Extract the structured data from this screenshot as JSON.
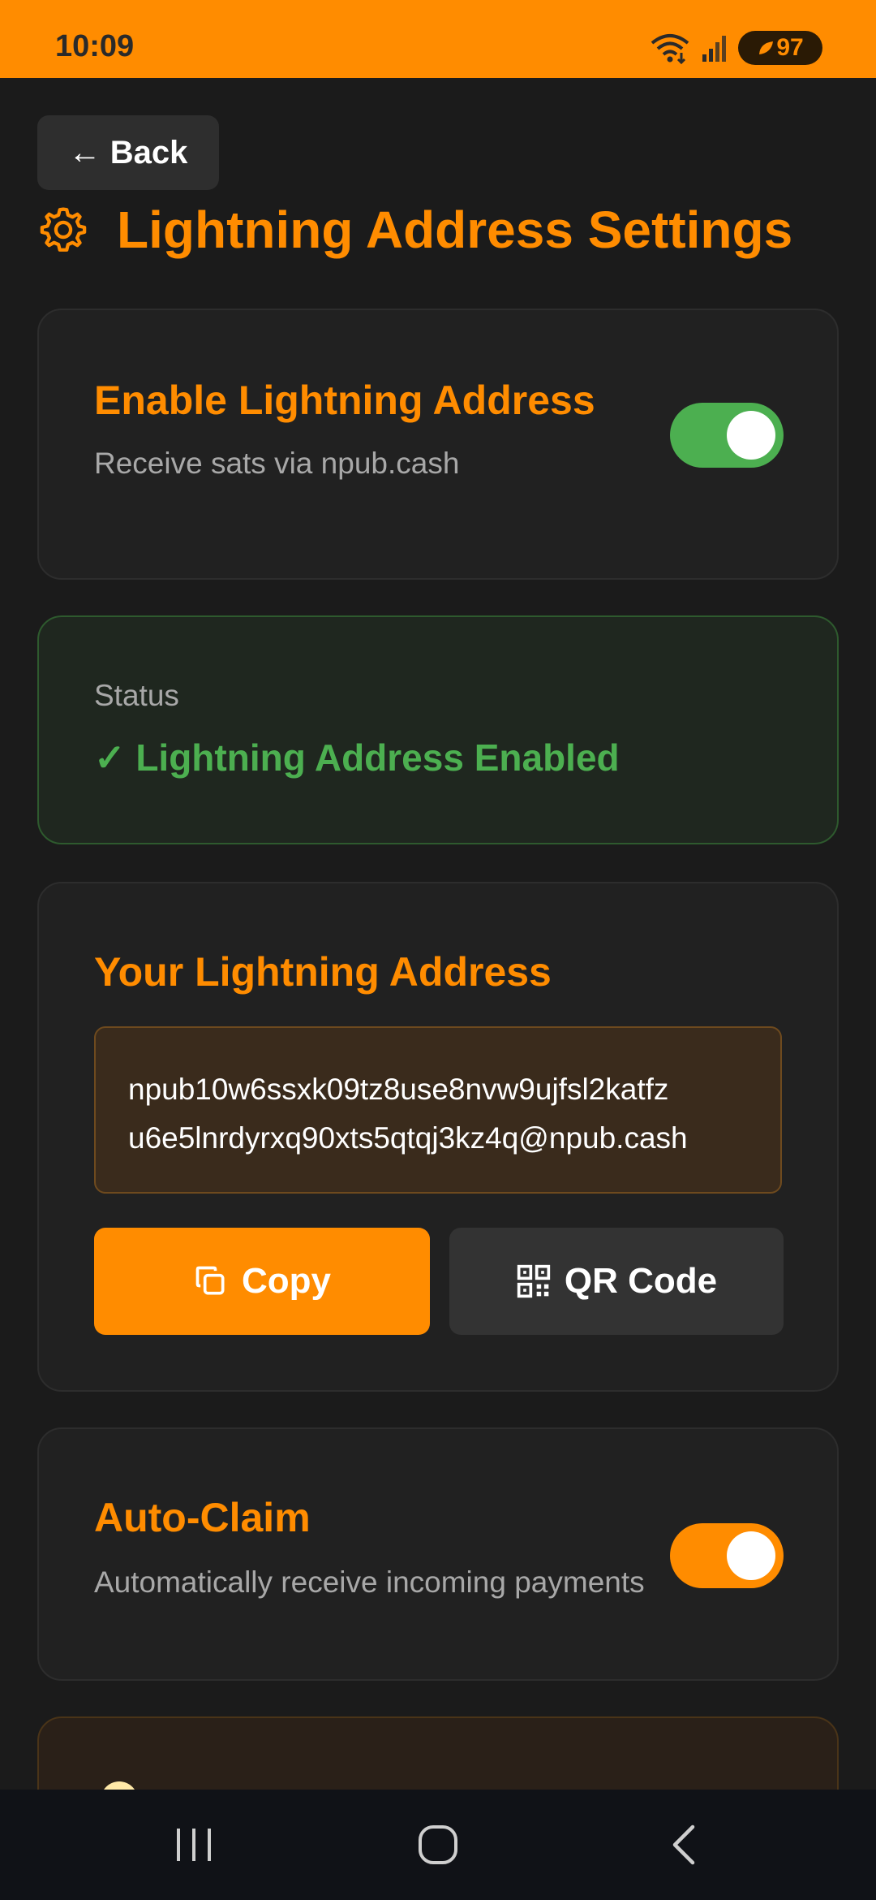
{
  "status_bar": {
    "time": "10:09",
    "battery": "97",
    "icons": [
      "wifi-icon",
      "signal-icon",
      "battery-icon"
    ]
  },
  "header": {
    "back_label": "← Back",
    "title": "Lightning Address Settings"
  },
  "enable_card": {
    "title": "Enable Lightning Address",
    "subtitle": "Receive sats via npub.cash",
    "enabled": true
  },
  "status_card": {
    "label": "Status",
    "value": "✓ Lightning Address Enabled"
  },
  "address_card": {
    "title": "Your Lightning Address",
    "address_line1": "npub10w6ssxk09tz8use8nvw9ujfsl2katfz",
    "address_line2": "u6e5lnrdyrxq90xts5qtqj3kz4q@npub.cash",
    "copy_label": "Copy",
    "qr_label": "QR Code"
  },
  "auto_claim_card": {
    "title": "Auto-Claim",
    "subtitle": "Automatically receive incoming payments",
    "enabled": true
  },
  "colors": {
    "accent": "#ff8c00",
    "success": "#4caf50",
    "background": "#1b1b1b",
    "card": "#212121"
  }
}
